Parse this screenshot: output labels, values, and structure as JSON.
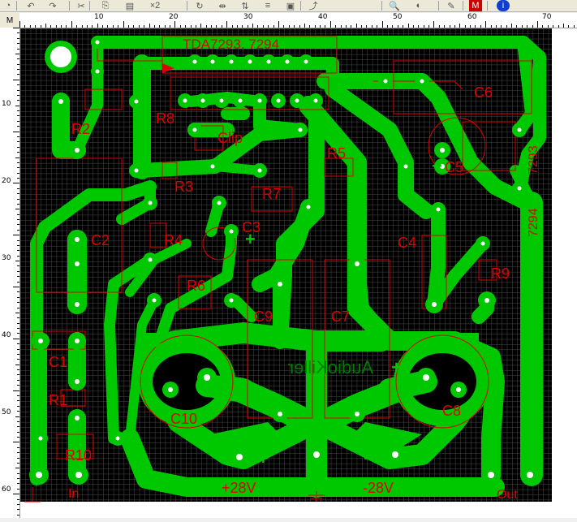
{
  "toolbar": {
    "icons": [
      "layer-icon",
      "undo-icon",
      "redo-icon",
      "cut-icon",
      "copy-icon",
      "paste-icon",
      "duplicate-icon",
      "rotate-icon",
      "mirror-h-icon",
      "mirror-v-icon",
      "align-icon",
      "group-icon",
      "route-icon",
      "zoom-icon",
      "drc-icon",
      "photo-view-icon",
      "macro-icon",
      "info-icon"
    ],
    "x2_label": "×2"
  },
  "ruler": {
    "unit_label": "M",
    "top_labels": [
      "10",
      "20",
      "30",
      "40",
      "50",
      "60",
      "70"
    ],
    "left_labels": [
      "10",
      "20",
      "30",
      "40",
      "50",
      "60"
    ]
  },
  "colors": {
    "board": "#000000",
    "grid": "#4a4a4a",
    "copper": "#00c800",
    "silk": "#ff0000",
    "pad_hole": "#ffffff"
  },
  "silkscreen": {
    "ic": "TDA7293, 7294",
    "r8": "R8",
    "r2": "R2",
    "clip": "Clip",
    "r5": "R5",
    "r3": "R3",
    "r7": "R7",
    "c3": "C3",
    "r4": "R4",
    "c2": "C2",
    "r6": "R6",
    "c4": "C4",
    "r9": "R9",
    "c9": "C9",
    "c7": "C7",
    "c1": "C1",
    "r1": "R1",
    "c10": "C10",
    "c8": "C8",
    "r10": "R10",
    "in": "In",
    "out": "Out",
    "plus28": "+28V",
    "minus28": "-28V",
    "c6": "C6",
    "c5": "C5",
    "ic_vert1": "7293",
    "ic_vert2": "7294",
    "audiokiller": "AudioKiller"
  }
}
